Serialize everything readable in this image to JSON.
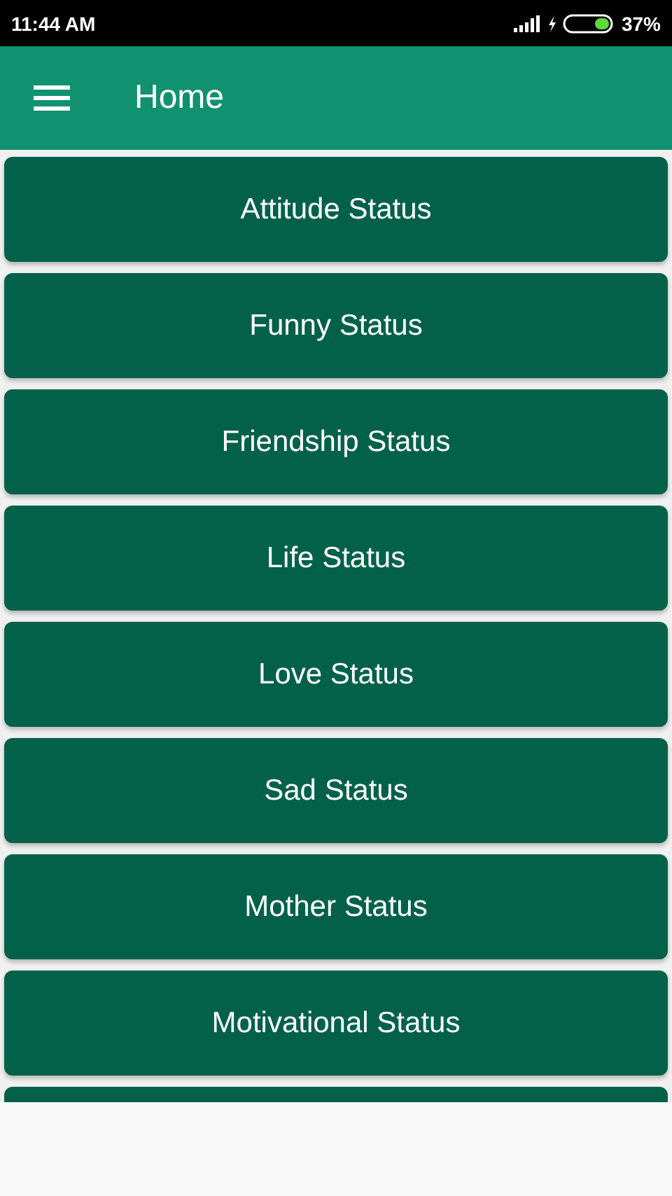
{
  "status_bar": {
    "time": "11:44 AM",
    "battery": "37%"
  },
  "app_bar": {
    "title": "Home"
  },
  "categories": [
    {
      "label": "Attitude Status"
    },
    {
      "label": "Funny Status"
    },
    {
      "label": "Friendship Status"
    },
    {
      "label": "Life Status"
    },
    {
      "label": "Love Status"
    },
    {
      "label": "Sad Status"
    },
    {
      "label": "Mother Status"
    },
    {
      "label": "Motivational Status"
    }
  ]
}
